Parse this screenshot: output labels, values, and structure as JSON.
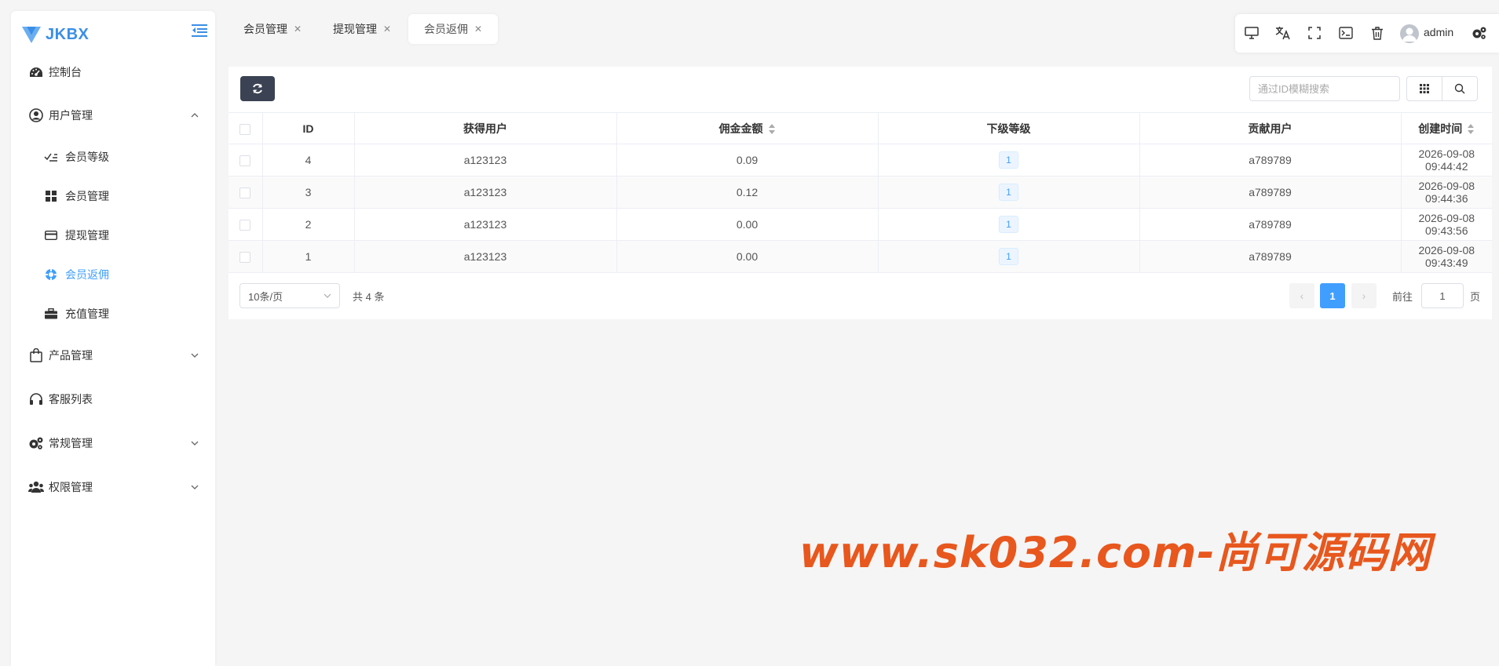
{
  "brand": {
    "name": "JKBX",
    "color": "#3a8ee6"
  },
  "sidebar": {
    "items": [
      {
        "label": "控制台",
        "icon": "dashboard-icon"
      },
      {
        "label": "用户管理",
        "icon": "user-circle-icon",
        "expanded": true,
        "children": [
          {
            "label": "会员等级",
            "icon": "level-icon"
          },
          {
            "label": "会员管理",
            "icon": "grid-icon"
          },
          {
            "label": "提现管理",
            "icon": "card-icon"
          },
          {
            "label": "会员返佣",
            "icon": "commission-icon",
            "active": true
          },
          {
            "label": "充值管理",
            "icon": "briefcase-icon"
          }
        ]
      },
      {
        "label": "产品管理",
        "icon": "shopping-bag-icon"
      },
      {
        "label": "客服列表",
        "icon": "headset-icon"
      },
      {
        "label": "常规管理",
        "icon": "cogs-icon"
      },
      {
        "label": "权限管理",
        "icon": "users-icon"
      }
    ]
  },
  "tabs": [
    {
      "label": "会员管理",
      "active": false
    },
    {
      "label": "提现管理",
      "active": false
    },
    {
      "label": "会员返佣",
      "active": true
    }
  ],
  "toolbar": {
    "icons": [
      "monitor-icon",
      "translate-icon",
      "fullscreen-icon",
      "terminal-icon",
      "trash-icon",
      "settings-icon"
    ],
    "username": "admin"
  },
  "search": {
    "placeholder": "通过ID模糊搜索"
  },
  "table": {
    "columns": [
      "ID",
      "获得用户",
      "佣金金额",
      "下级等级",
      "贡献用户",
      "创建时间"
    ],
    "rows": [
      {
        "id": "4",
        "user": "a123123",
        "amount": "0.09",
        "level": "1",
        "contributor": "a789789",
        "created": "2026-09-08 09:44:42"
      },
      {
        "id": "3",
        "user": "a123123",
        "amount": "0.12",
        "level": "1",
        "contributor": "a789789",
        "created": "2026-09-08 09:44:36"
      },
      {
        "id": "2",
        "user": "a123123",
        "amount": "0.00",
        "level": "1",
        "contributor": "a789789",
        "created": "2026-09-08 09:43:56"
      },
      {
        "id": "1",
        "user": "a123123",
        "amount": "0.00",
        "level": "1",
        "contributor": "a789789",
        "created": "2026-09-08 09:43:49"
      }
    ]
  },
  "pagination": {
    "page_size": "10条/页",
    "total": "共 4 条",
    "current": "1",
    "goto_prefix": "前往",
    "goto_value": "1",
    "goto_suffix": "页",
    "prev": "‹",
    "next": "›"
  },
  "watermark": "www.sk032.com-尚可源码网"
}
